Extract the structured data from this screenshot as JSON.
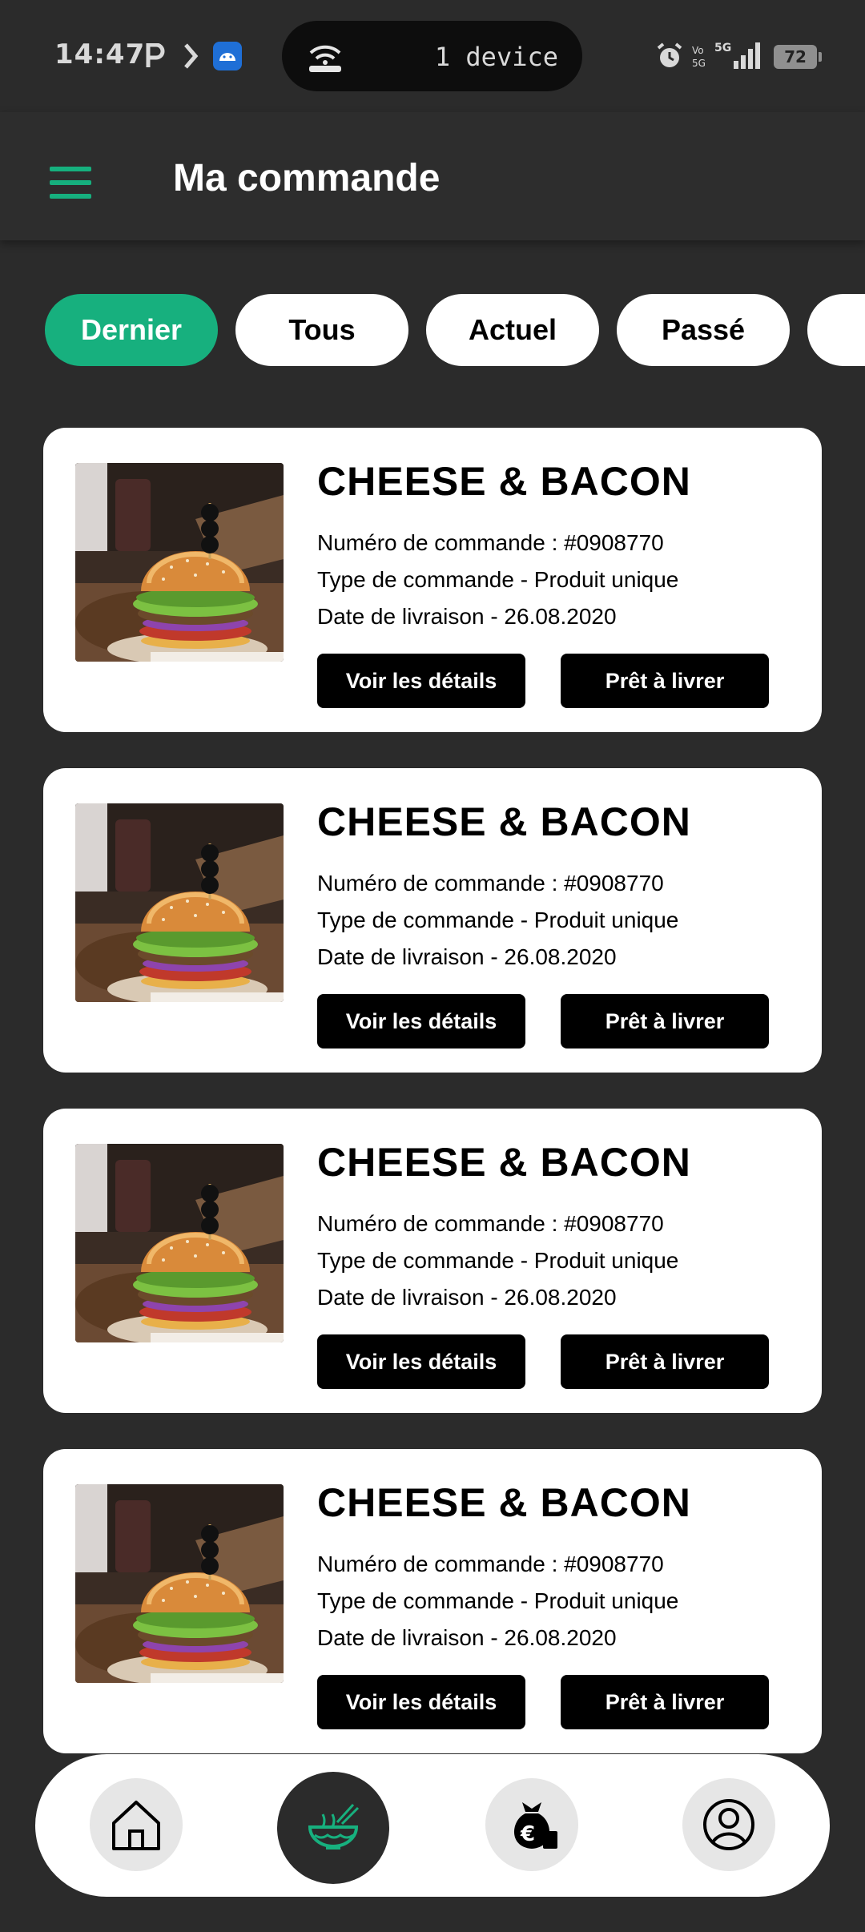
{
  "status_bar": {
    "time": "14:47",
    "pill_text": "1 device",
    "battery": "72"
  },
  "app_bar": {
    "title": "Ma commande"
  },
  "filters": {
    "items": [
      {
        "label": "Dernier",
        "active": true
      },
      {
        "label": "Tous",
        "active": false
      },
      {
        "label": "Actuel",
        "active": false
      },
      {
        "label": "Passé",
        "active": false
      },
      {
        "label": "",
        "active": false
      }
    ]
  },
  "orders": [
    {
      "title": "CHEESE & BACON",
      "order_number": "Numéro de commande : #0908770",
      "order_type": "Type de commande - Produit unique",
      "delivery_date": "Date de livraison - 26.08.2020",
      "details_label": "Voir les détails",
      "ready_label": "Prêt à livrer"
    },
    {
      "title": "CHEESE & BACON",
      "order_number": "Numéro de commande : #0908770",
      "order_type": "Type de commande - Produit unique",
      "delivery_date": "Date de livraison - 26.08.2020",
      "details_label": "Voir les détails",
      "ready_label": "Prêt à livrer"
    },
    {
      "title": "CHEESE & BACON",
      "order_number": "Numéro de commande : #0908770",
      "order_type": "Type de commande - Produit unique",
      "delivery_date": "Date de livraison - 26.08.2020",
      "details_label": "Voir les détails",
      "ready_label": "Prêt à livrer"
    },
    {
      "title": "CHEESE & BACON",
      "order_number": "Numéro de commande : #0908770",
      "order_type": "Type de commande - Produit unique",
      "delivery_date": "Date de livraison - 26.08.2020",
      "details_label": "Voir les détails",
      "ready_label": "Prêt à livrer"
    }
  ],
  "bottom_nav": {
    "items": [
      {
        "icon": "home-icon",
        "active": false
      },
      {
        "icon": "food-bowl-icon",
        "active": true
      },
      {
        "icon": "money-bag-euro-icon",
        "active": false
      },
      {
        "icon": "profile-icon",
        "active": false
      }
    ]
  },
  "colors": {
    "accent": "#17b07e",
    "background": "#2b2b2b",
    "card": "#ffffff",
    "button": "#000000"
  }
}
